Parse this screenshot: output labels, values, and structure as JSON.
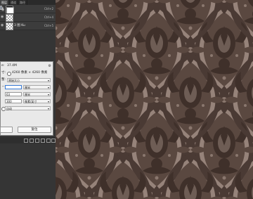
{
  "panel": {
    "tabs": [
      "图层",
      "通道",
      "路径"
    ],
    "layers": [
      {
        "name": "",
        "right": "Ctrl+2",
        "thumb": "black",
        "selected": false
      },
      {
        "name": "",
        "right": "Ctrl+3",
        "thumb": "white",
        "selected": true
      },
      {
        "name": "",
        "right": "Ctrl+4",
        "thumb": "check",
        "selected": false
      },
      {
        "name": "3 图 Ku",
        "right": "Ctrl+5",
        "thumb": "check",
        "selected": false
      }
    ]
  },
  "dialog": {
    "size_label": "e:",
    "size_value": "37.4M",
    "dims_value": "4260 像素 × 4260 像素",
    "fit_label": "整:",
    "fit_value": "原始大小",
    "width_value": "",
    "width_unit": "厘米",
    "height_value": "63",
    "height_unit": "厘米",
    "resolution_value": "300",
    "resolution_unit": "像素/英寸",
    "resample_value": "自动",
    "ok_label": "",
    "cancel_label": "复位"
  },
  "icons": {
    "gear": "gear-icon",
    "eye": "eye-icon",
    "chain": "chain-icon",
    "chevron": "chevron-down-icon"
  },
  "colors": {
    "pattern_bg": "#96837a",
    "pattern_dark": "#4a3a34",
    "pattern_mid": "#6e5d55",
    "selection": "#5b6a85"
  }
}
